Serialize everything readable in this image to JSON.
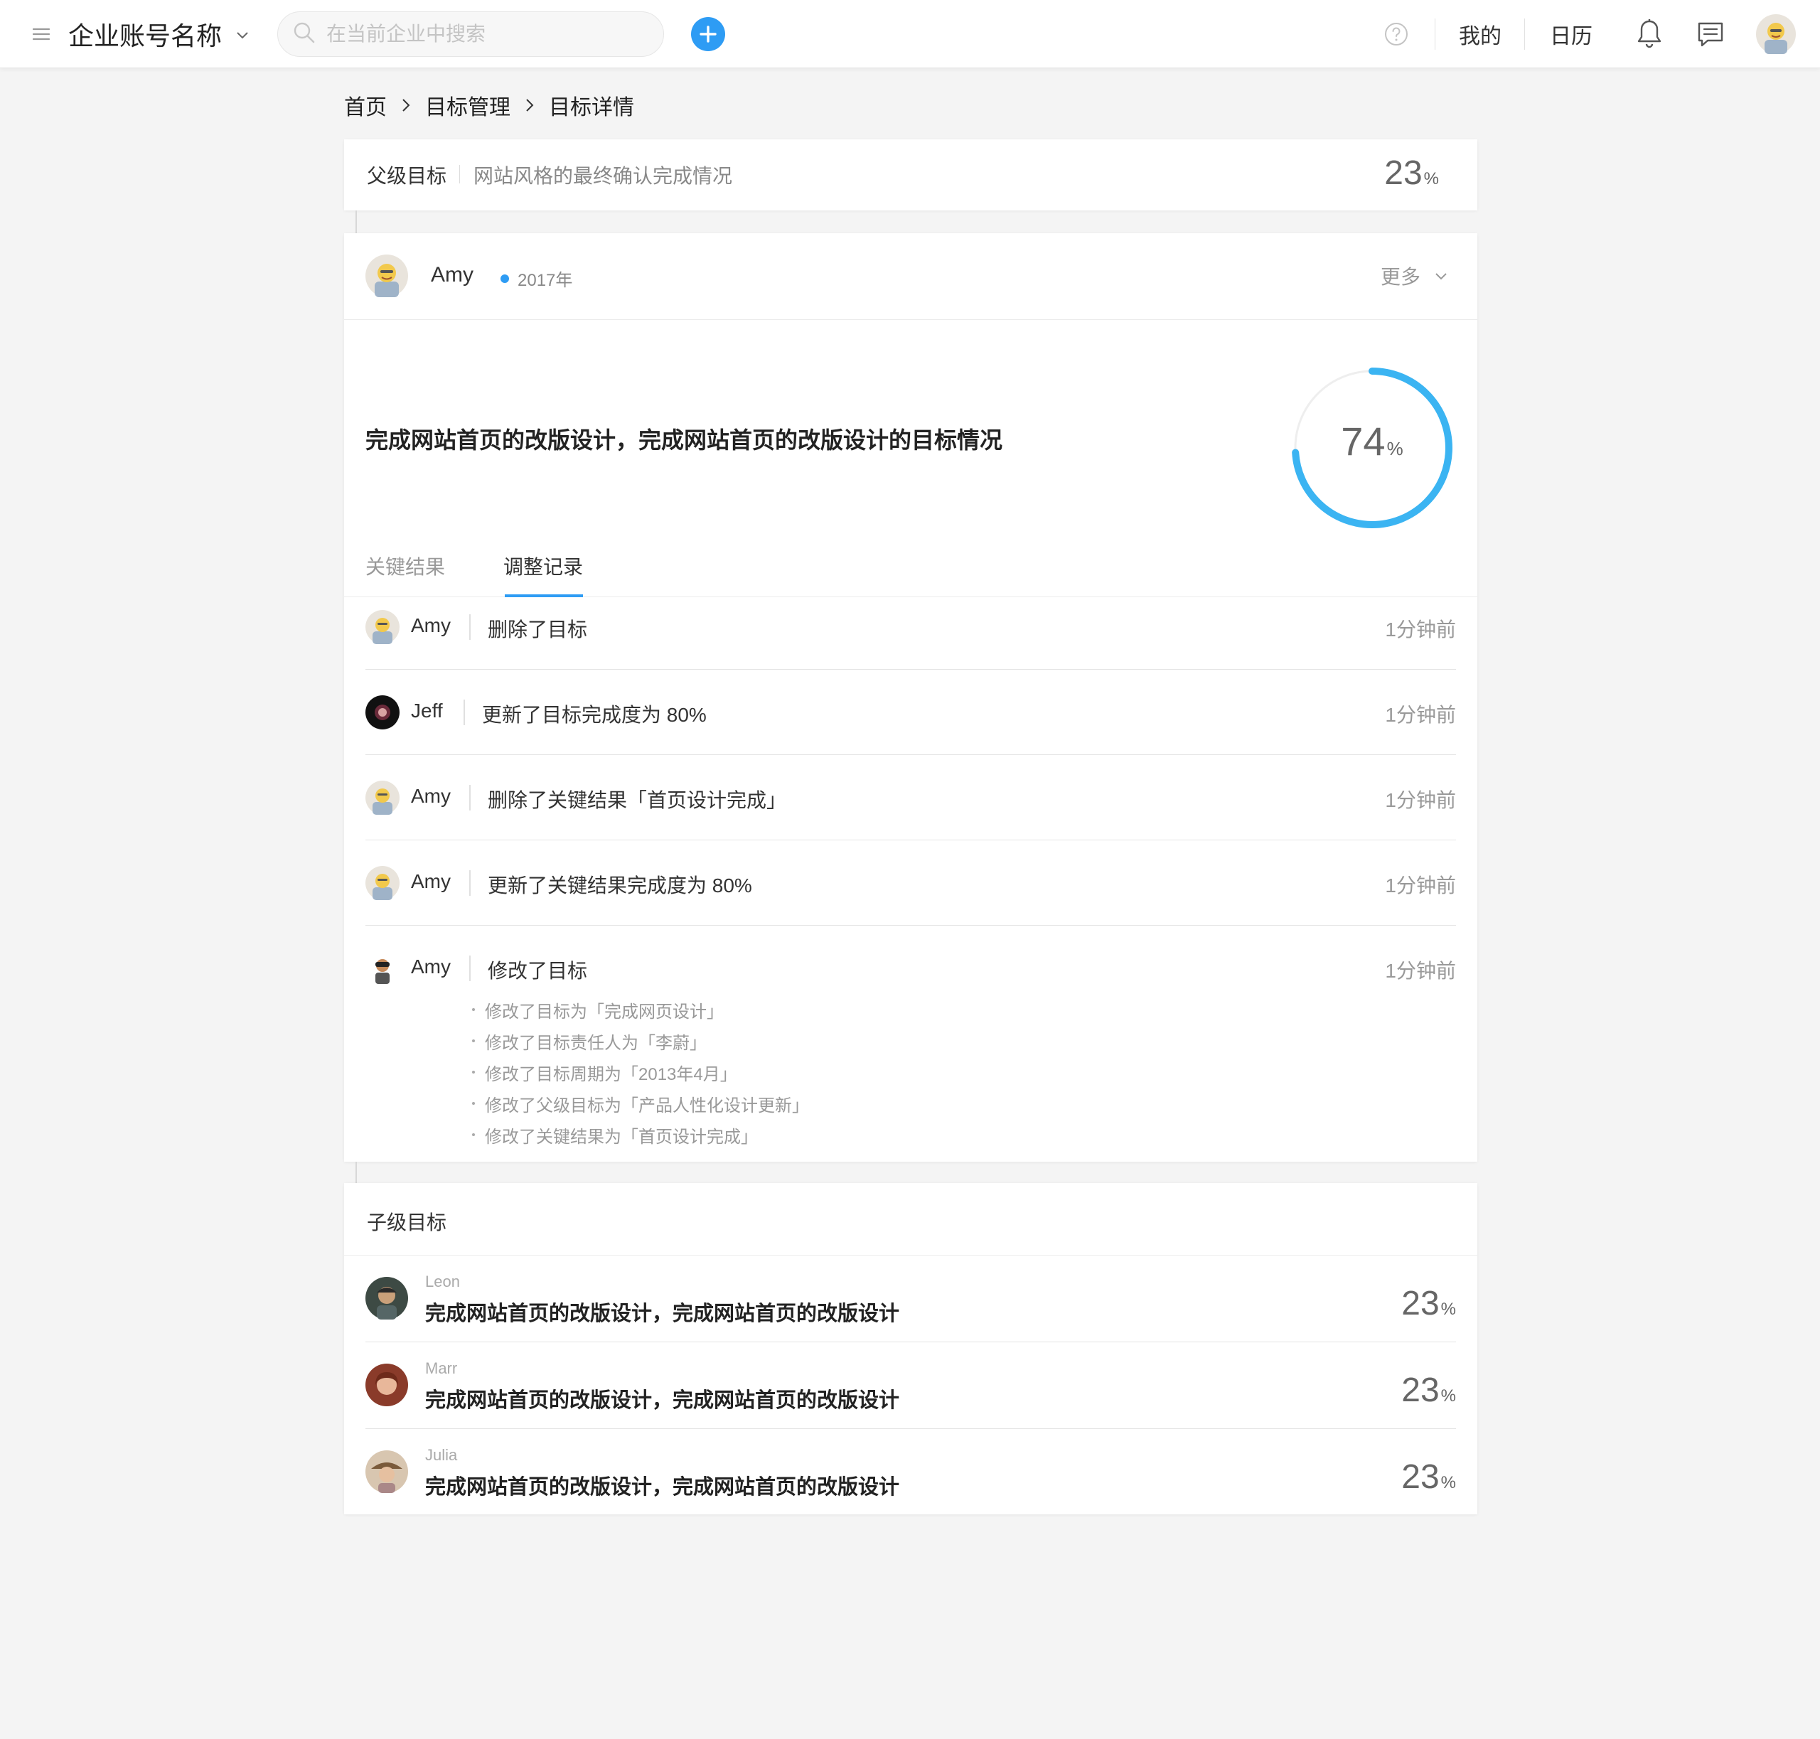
{
  "header": {
    "company_name": "企业账号名称",
    "search_placeholder": "在当前企业中搜索",
    "nav_mine": "我的",
    "nav_calendar": "日历"
  },
  "breadcrumb": [
    "首页",
    "目标管理",
    "目标详情"
  ],
  "parent_goal": {
    "label": "父级目标",
    "title": "网站风格的最终确认完成情况",
    "progress_value": "23",
    "progress_unit": "%"
  },
  "goal": {
    "owner": "Amy",
    "period": "2017年",
    "more_label": "更多",
    "title": "完成网站首页的改版设计，完成网站首页的改版设计的目标情况",
    "progress_value": "74",
    "progress_unit": "%",
    "progress_fraction": 0.74
  },
  "tabs": [
    {
      "label": "关键结果",
      "active": false
    },
    {
      "label": "调整记录",
      "active": true
    }
  ],
  "logs": [
    {
      "user": "Amy",
      "action": "删除了目标",
      "time": "1分钟前"
    },
    {
      "user": "Jeff",
      "action": "更新了目标完成度为 80%",
      "time": "1分钟前"
    },
    {
      "user": "Amy",
      "action": "删除了关键结果「首页设计完成」",
      "time": "1分钟前"
    },
    {
      "user": "Amy",
      "action": "更新了关键结果完成度为 80%",
      "time": "1分钟前"
    },
    {
      "user": "Amy",
      "action": "修改了目标",
      "time": "1分钟前",
      "details": [
        "修改了目标为「完成网页设计」",
        "修改了目标责任人为「李蔚」",
        "修改了目标周期为「2013年4月」",
        "修改了父级目标为「产品人性化设计更新」",
        "修改了关键结果为「首页设计完成」"
      ]
    }
  ],
  "children": {
    "label": "子级目标",
    "items": [
      {
        "owner": "Leon",
        "title": "完成网站首页的改版设计，完成网站首页的改版设计",
        "progress_value": "23",
        "progress_unit": "%"
      },
      {
        "owner": "Marr",
        "title": "完成网站首页的改版设计，完成网站首页的改版设计",
        "progress_value": "23",
        "progress_unit": "%"
      },
      {
        "owner": "Julia",
        "title": "完成网站首页的改版设计，完成网站首页的改版设计",
        "progress_value": "23",
        "progress_unit": "%"
      }
    ]
  },
  "colors": {
    "accent": "#2e9cf4",
    "ring": "#3bb4f2",
    "background": "#f4f4f4"
  },
  "icons": [
    "menu-icon",
    "chevron-down-icon",
    "search-icon",
    "plus-icon",
    "help-icon",
    "bell-icon",
    "message-icon",
    "chevron-right-icon",
    "avatar"
  ]
}
